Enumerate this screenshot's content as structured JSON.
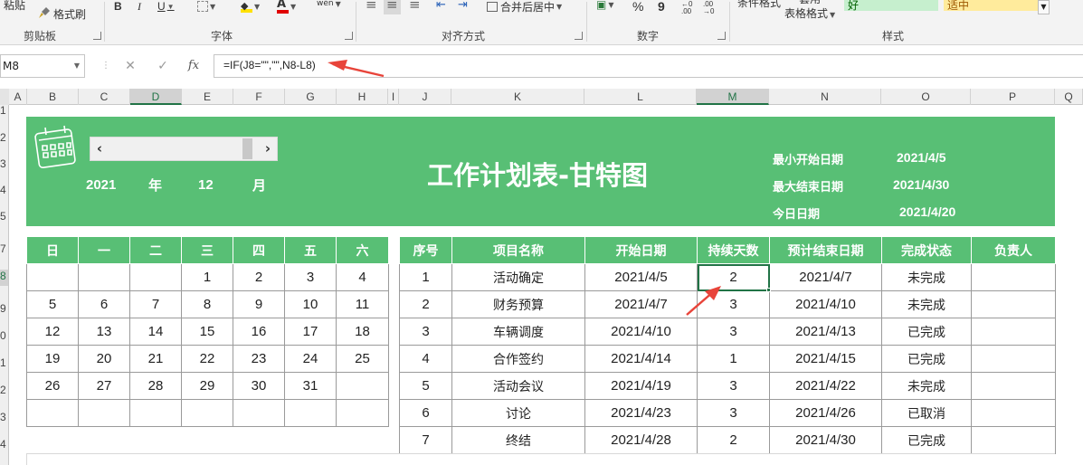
{
  "ribbon": {
    "clipboard": {
      "top_label": "粘贴",
      "format_painter": "格式刷",
      "group": "剪贴板"
    },
    "font": {
      "bold": "B",
      "italic": "I",
      "underline": "U",
      "group": "字体"
    },
    "alignment": {
      "merge_center": "合并后居中",
      "group": "对齐方式",
      "wen": "wén"
    },
    "number": {
      "percent": "%",
      "comma": "9",
      "group": "数字"
    },
    "styles": {
      "cond_format": "条件格式",
      "table_format_top": "套用",
      "table_format": "表格格式",
      "good": "好",
      "neutral": "适中",
      "group": "样式"
    }
  },
  "formula_bar": {
    "cell_ref": "M8",
    "cancel": "✕",
    "enter": "✓",
    "fx": "fx",
    "formula": "=IF(J8=\"\",\"\",N8-L8)"
  },
  "columns": [
    "A",
    "B",
    "C",
    "D",
    "E",
    "F",
    "G",
    "H",
    "I",
    "J",
    "K",
    "L",
    "M",
    "N",
    "O",
    "P",
    "Q"
  ],
  "rows": [
    "1",
    "2",
    "3",
    "4",
    "5",
    "7",
    "8",
    "9",
    "0",
    "1",
    "2",
    "3",
    "4"
  ],
  "banner": {
    "year": "2021",
    "year_unit": "年",
    "month": "12",
    "month_unit": "月",
    "title": "工作计划表-甘特图",
    "min_start_label": "最小开始日期",
    "min_start_value": "2021/4/5",
    "max_end_label": "最大结束日期",
    "max_end_value": "2021/4/30",
    "today_label": "今日日期",
    "today_value": "2021/4/20"
  },
  "calendar": {
    "weekdays": [
      "日",
      "一",
      "二",
      "三",
      "四",
      "五",
      "六"
    ],
    "weeks": [
      [
        "",
        "",
        "",
        "1",
        "2",
        "3",
        "4"
      ],
      [
        "5",
        "6",
        "7",
        "8",
        "9",
        "10",
        "11"
      ],
      [
        "12",
        "13",
        "14",
        "15",
        "16",
        "17",
        "18"
      ],
      [
        "19",
        "20",
        "21",
        "22",
        "23",
        "24",
        "25"
      ],
      [
        "26",
        "27",
        "28",
        "29",
        "30",
        "31",
        ""
      ],
      [
        "",
        "",
        "",
        "",
        "",
        "",
        ""
      ]
    ]
  },
  "tasks": {
    "headers": [
      "序号",
      "项目名称",
      "开始日期",
      "持续天数",
      "预计结束日期",
      "完成状态",
      "负责人"
    ],
    "rows": [
      [
        "1",
        "活动确定",
        "2021/4/5",
        "2",
        "2021/4/7",
        "未完成",
        ""
      ],
      [
        "2",
        "财务预算",
        "2021/4/7",
        "3",
        "2021/4/10",
        "未完成",
        ""
      ],
      [
        "3",
        "车辆调度",
        "2021/4/10",
        "3",
        "2021/4/13",
        "已完成",
        ""
      ],
      [
        "4",
        "合作签约",
        "2021/4/14",
        "1",
        "2021/4/15",
        "已完成",
        ""
      ],
      [
        "5",
        "活动会议",
        "2021/4/19",
        "3",
        "2021/4/22",
        "未完成",
        ""
      ],
      [
        "6",
        "讨论",
        "2021/4/23",
        "3",
        "2021/4/26",
        "已取消",
        ""
      ],
      [
        "7",
        "终结",
        "2021/4/28",
        "2",
        "2021/4/30",
        "已完成",
        ""
      ]
    ]
  },
  "colors": {
    "accent_green": "#58bf75",
    "excel_green": "#217346",
    "arrow_red": "#e8443a"
  }
}
